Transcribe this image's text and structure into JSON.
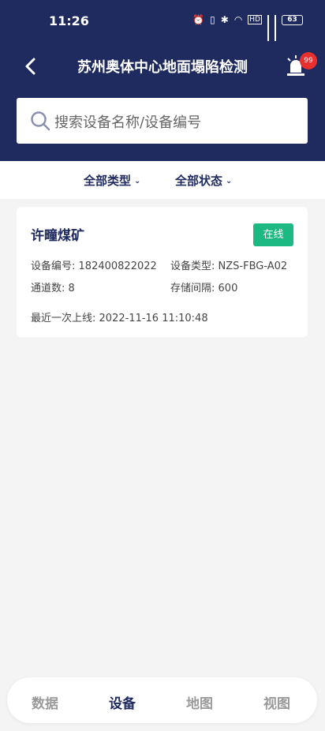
{
  "status_bar": {
    "time": "11:26",
    "network": "4G",
    "hd": "HD",
    "battery": "63"
  },
  "header": {
    "title": "苏州奥体中心地面塌陷检测",
    "alarm_count": "99"
  },
  "search": {
    "placeholder": "搜索设备名称/设备编号"
  },
  "filters": {
    "type_label": "全部类型",
    "status_label": "全部状态"
  },
  "devices": [
    {
      "name": "许疃煤矿",
      "status": "在线",
      "code_label": "设备编号:",
      "code": "182400822022",
      "type_label": "设备类型:",
      "type": "NZS-FBG-A02",
      "channels_label": "通道数:",
      "channels": "8",
      "interval_label": "存储间隔:",
      "interval": "600",
      "last_online_label": "最近一次上线:",
      "last_online": "2022-11-16 11:10:48"
    }
  ],
  "tabs": [
    {
      "label": "数据"
    },
    {
      "label": "设备"
    },
    {
      "label": "地图"
    },
    {
      "label": "视图"
    }
  ],
  "colors": {
    "header_bg": "#1f2a5e",
    "online_badge": "#1db982",
    "alarm_badge": "#e8312f"
  }
}
